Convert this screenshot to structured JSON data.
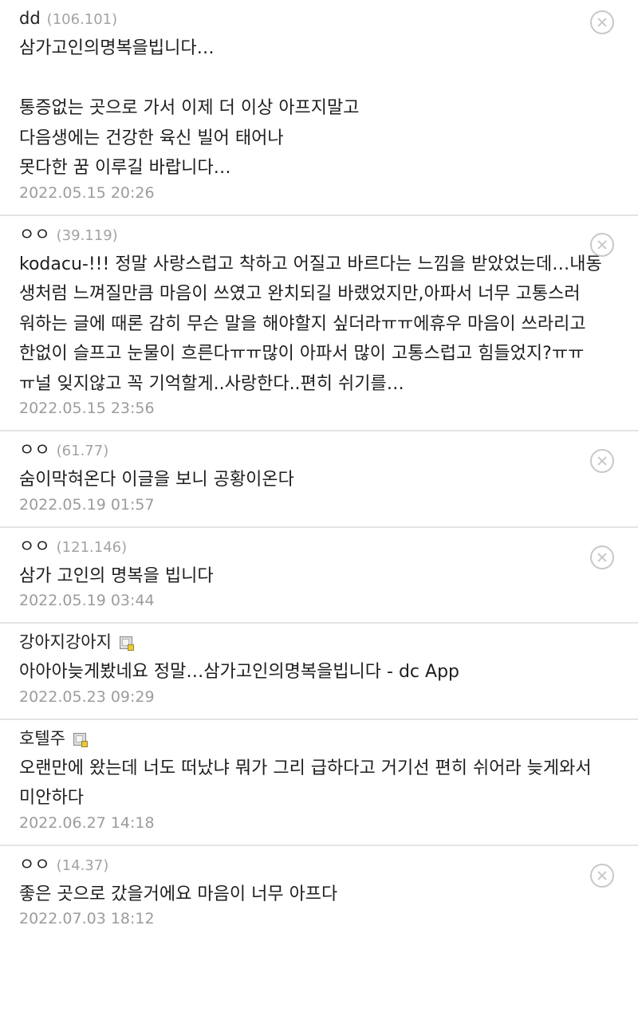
{
  "comments": [
    {
      "nick": "dd",
      "ip": "(106.101)",
      "lines": [
        "삼가고인의명복을빕니다…",
        "",
        "통증없는 곳으로 가서 이제 더 이상 아프지말고",
        "다음생에는 건강한 육신 빌어 태어나",
        "못다한 꿈 이루길 바랍니다…"
      ],
      "date": "2022.05.15 20:26"
    },
    {
      "nick": "ㅇㅇ",
      "ip": "(39.119)",
      "lines": [
        "kodacu-!!! 정말 사랑스럽고 착하고 어질고 바르다는 느낌을 받았었는데…내동",
        "생처럼 느껴질만큼 마음이 쓰였고 완치되길 바랬었지만,아파서 너무 고통스러",
        "워하는 글에 때론 감히 무슨 말을 해야할지 싶더라ㅠㅠ에휴우 마음이 쓰라리고",
        "한없이 슬프고 눈물이 흐른다ㅠㅠ많이 아파서 많이 고통스럽고 힘들었지?ㅠㅠ",
        "ㅠ널 잊지않고 꼭 기억할게..사랑한다..편히 쉬기를…"
      ],
      "date": "2022.05.15 23:56"
    },
    {
      "nick": "ㅇㅇ",
      "ip": "(61.77)",
      "lines": [
        "숨이막혀온다 이글을 보니 공황이온다"
      ],
      "date": "2022.05.19 01:57"
    },
    {
      "nick": "ㅇㅇ",
      "ip": "(121.146)",
      "lines": [
        "삼가 고인의 명복을 빕니다"
      ],
      "date": "2022.05.19 03:44"
    },
    {
      "nick": "강아지강아지",
      "ip": "",
      "lines": [
        "아아아늦게봤네요 정말…삼가고인의명복을빕니다 - dc App"
      ],
      "date": "2022.05.23 09:29"
    },
    {
      "nick": "호텔주",
      "ip": "",
      "lines": [
        "오랜만에 왔는데 너도 떠났냐 뭐가 그리 급하다고 거기선 편히 쉬어라 늦게와서",
        "미안하다"
      ],
      "date": "2022.06.27 14:18"
    },
    {
      "nick": "ㅇㅇ",
      "ip": "(14.37)",
      "lines": [
        "좋은 곳으로 갔을거에요 마음이 너무 아프다"
      ],
      "date": "2022.07.03 18:12"
    }
  ]
}
